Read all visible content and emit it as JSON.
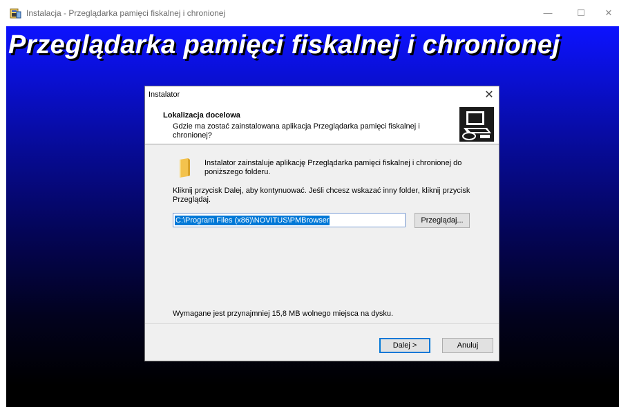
{
  "outer_window": {
    "title": "Instalacja - Przeglądarka pamięci fiskalnej i chronionej",
    "icon": "installer-icon",
    "controls": {
      "minimize": "—",
      "maximize": "☐",
      "close": "✕"
    }
  },
  "backdrop": {
    "title": "Przeglądarka pamięci fiskalnej i chronionej"
  },
  "dialog": {
    "title": "Instalator",
    "close": "✕",
    "header": {
      "title": "Lokalizacja docelowa",
      "subtitle": "Gdzie ma zostać zainstalowana aplikacja Przeglądarka pamięci fiskalnej i chronionej?",
      "icon": "computer-install-icon"
    },
    "intro": "Instalator zainstaluje aplikację Przeglądarka pamięci fiskalnej i chronionej do poniższego folderu.",
    "instruction": "Kliknij przycisk Dalej, aby kontynuować. Jeśli chcesz wskazać inny folder, kliknij przycisk Przeglądaj.",
    "path_value": "C:\\Program Files (x86)\\NOVITUS\\PMBrowser",
    "browse_label": "Przeglądaj...",
    "space_required": "Wymagane jest przynajmniej 15,8 MB wolnego miejsca na dysku.",
    "next_label": "Dalej >",
    "cancel_label": "Anuluj"
  },
  "colors": {
    "backdrop_top": "#0d12ff",
    "backdrop_bottom": "#000000",
    "selection": "#0078d7"
  }
}
